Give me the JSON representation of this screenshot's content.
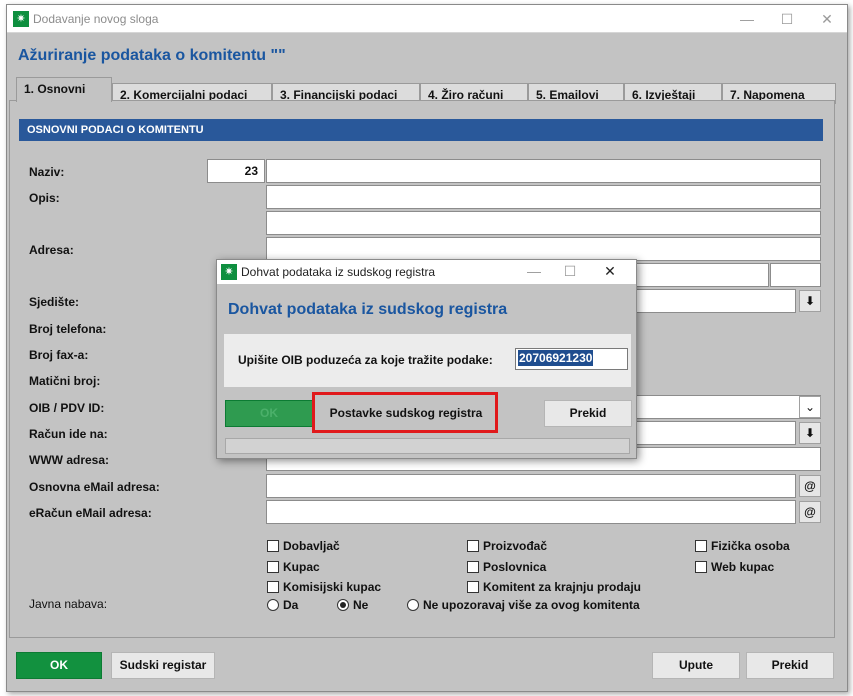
{
  "window": {
    "title": "Dodavanje novog sloga",
    "heading": "Ažuriranje podataka o komitentu \"\""
  },
  "tabs": [
    {
      "label": "1. Osnovni"
    },
    {
      "label": "2. Komercijalni podaci"
    },
    {
      "label": "3. Financijski podaci"
    },
    {
      "label": "4. Žiro računi"
    },
    {
      "label": "5. Emailovi"
    },
    {
      "label": "6. Izvještaji"
    },
    {
      "label": "7. Napomena"
    }
  ],
  "section_title": "OSNOVNI PODACI O KOMITENTU",
  "fields": {
    "naziv": "Naziv:",
    "naziv_code": "23",
    "opis": "Opis:",
    "adresa": "Adresa:",
    "sjediste": "Sjedište:",
    "broj_telefona": "Broj telefona:",
    "broj_fax": "Broj fax-a:",
    "maticni_broj": "Matični broj:",
    "oib": "OIB / PDV ID:",
    "racun_ide_na": "Račun ide na:",
    "www": "WWW adresa:",
    "osnovna_email": "Osnovna eMail adresa:",
    "eracun_email": "eRačun eMail adresa:",
    "javna_nabava": "Javna nabava:"
  },
  "checkboxes": {
    "dobavljac": "Dobavljač",
    "kupac": "Kupac",
    "komisijski_kupac": "Komisijski kupac",
    "proizvodac": "Proizvođač",
    "poslovnica": "Poslovnica",
    "komitent_krajnja": "Komitent za krajnju prodaju",
    "fizicka_osoba": "Fizička osoba",
    "web_kupac": "Web kupac"
  },
  "radios": {
    "da": "Da",
    "ne": "Ne",
    "ne_upozoravaj": "Ne upozoravaj više za ovog komitenta",
    "selected": "Ne"
  },
  "icons": {
    "at": "@",
    "dropdown": "⬇",
    "chevron": "⌄"
  },
  "buttons": {
    "ok": "OK",
    "sudski_registar": "Sudski registar",
    "upute": "Upute",
    "prekid": "Prekid"
  },
  "dialog": {
    "title": "Dohvat podataka iz sudskog registra",
    "heading": "Dohvat podataka iz sudskog registra",
    "prompt": "Upišite OIB poduzeća za koje tražite podake:",
    "oib_value": "20706921230",
    "ok": "OK",
    "postavke": "Postavke sudskog registra",
    "prekid": "Prekid"
  },
  "colors": {
    "accent_blue": "#1a56a0",
    "section_bar": "#29589a",
    "green_button": "#12913f",
    "highlight_red": "#e0191b"
  }
}
